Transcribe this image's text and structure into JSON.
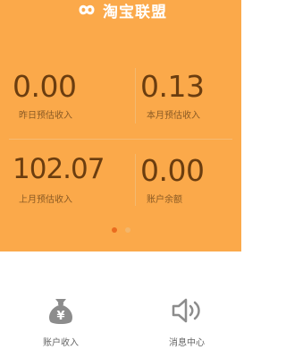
{
  "app": {
    "title": "淘宝联盟"
  },
  "stats": [
    {
      "value": "0.00",
      "label": "昨日预估收入"
    },
    {
      "value": "0.13",
      "label": "本月预估收入"
    },
    {
      "value": "102.07",
      "label": "上月预估收入"
    },
    {
      "value": "0.00",
      "label": "账户余额"
    }
  ],
  "pager": {
    "total": 2,
    "active": 1
  },
  "nav": [
    {
      "label": "账户收入",
      "icon": "money-bag-icon"
    },
    {
      "label": "消息中心",
      "icon": "speaker-icon"
    }
  ],
  "colors": {
    "panel": "#fba94a",
    "value_text": "#6b3d0f",
    "label_text": "#8a5a24",
    "dot_active": "#ea6c1f",
    "dot_inactive": "#f3b66b",
    "icon_gray": "#888888"
  }
}
